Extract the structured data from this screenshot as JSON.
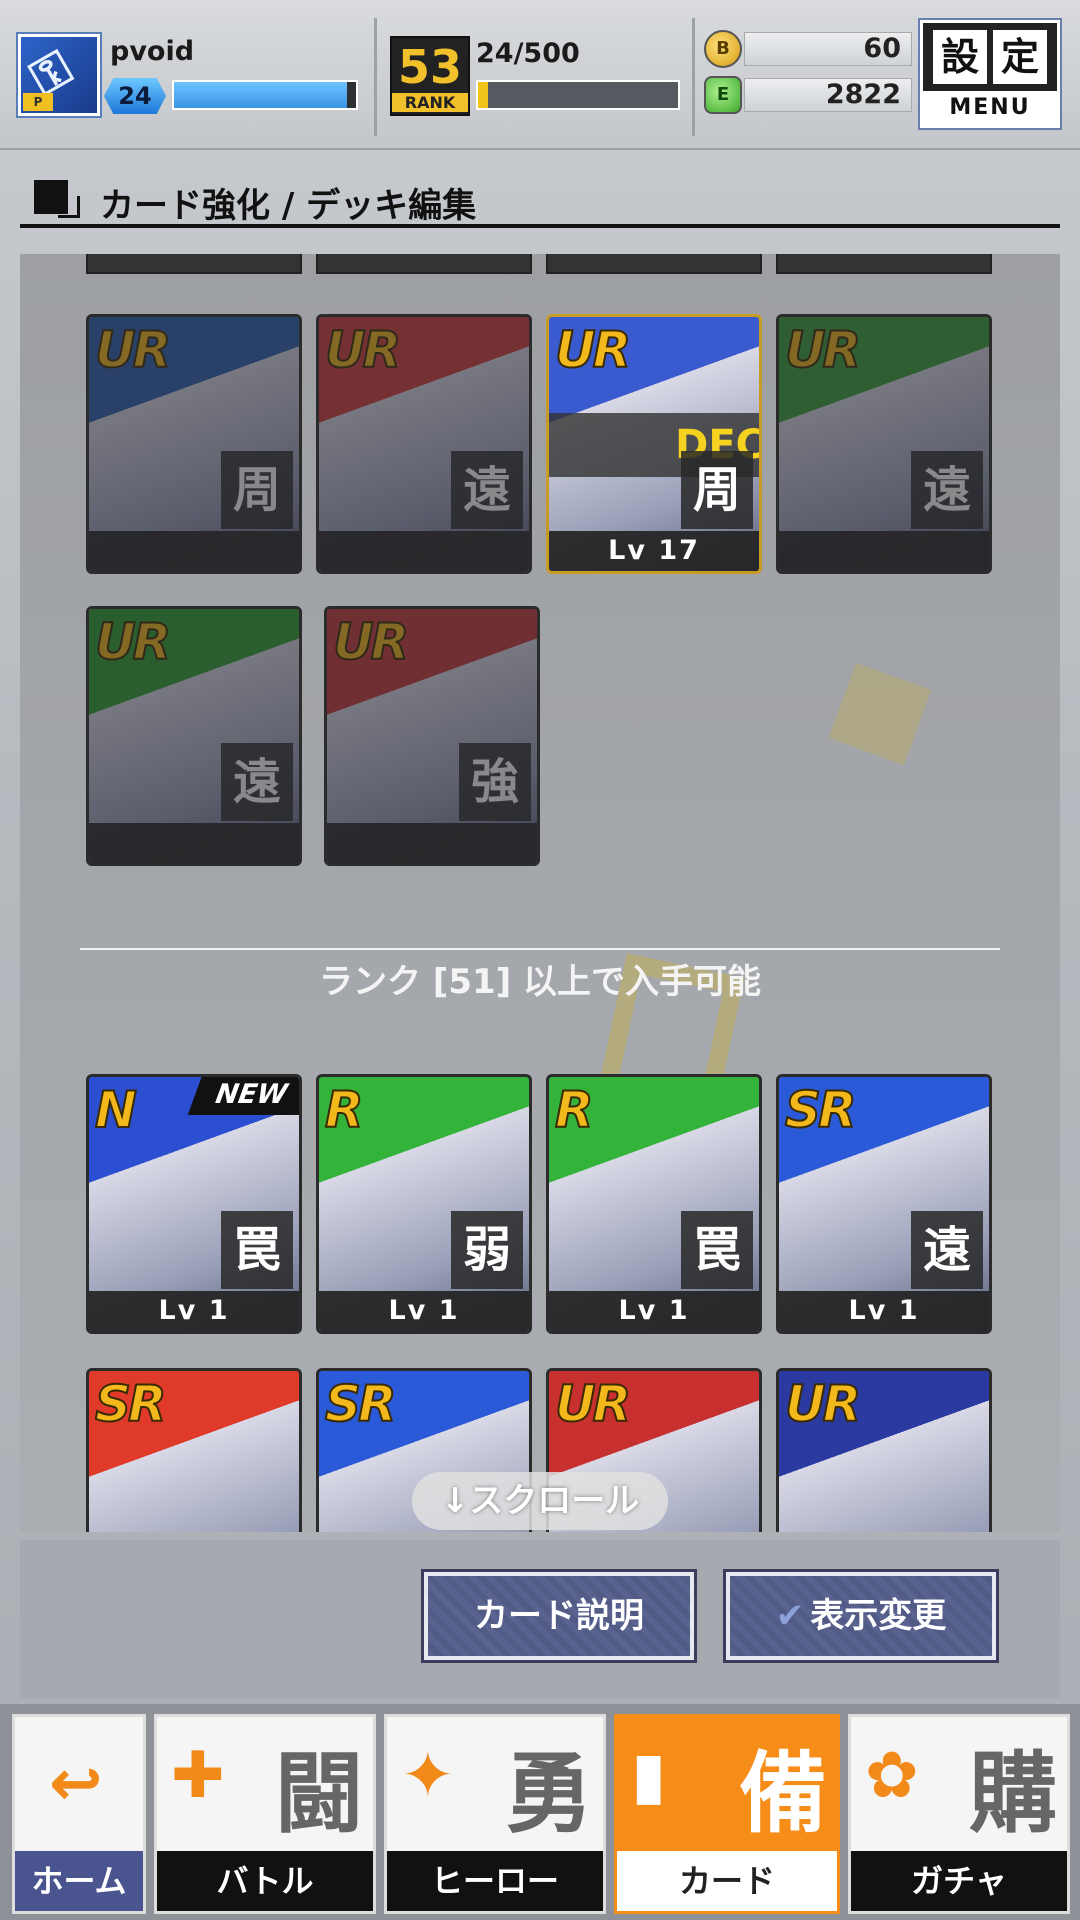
{
  "header": {
    "username": "pvoid",
    "level": "24",
    "exp_fill": 0.95,
    "rank_number": "53",
    "rank_label": "RANK",
    "rank_progress": "24/500",
    "rank_fill": 0.048,
    "gold_coins": "60",
    "green_gems": "2822",
    "menu_kanji_1": "設",
    "menu_kanji_2": "定",
    "menu_label": "MENU"
  },
  "section": {
    "title": "カード強化 / デッキ編集"
  },
  "owned_cards": [
    {
      "rarity": "UR",
      "type": "周",
      "level": "",
      "dim": true,
      "accent": "#2c5fb0"
    },
    {
      "rarity": "UR",
      "type": "遠",
      "level": "",
      "dim": true,
      "accent": "#d33a3a"
    },
    {
      "rarity": "UR",
      "type": "周",
      "level": "Lv 17",
      "dim": false,
      "accent": "#3a5ad0",
      "dec_label": "DEC"
    },
    {
      "rarity": "UR",
      "type": "遠",
      "level": "",
      "dim": true,
      "accent": "#3aa13a"
    },
    {
      "rarity": "UR",
      "type": "遠",
      "level": "",
      "dim": true,
      "accent": "#2fa02f"
    },
    {
      "rarity": "UR",
      "type": "強",
      "level": "",
      "dim": true,
      "accent": "#c83a3a"
    }
  ],
  "unlock_text": "ランク [51] 以上で入手可能",
  "available_cards": [
    {
      "rarity": "N",
      "type": "罠",
      "level": "Lv 1",
      "accent": "#2b4fd0",
      "new_label": "NEW"
    },
    {
      "rarity": "R",
      "type": "弱",
      "level": "Lv 1",
      "accent": "#33b33a"
    },
    {
      "rarity": "R",
      "type": "罠",
      "level": "Lv 1",
      "accent": "#33b33a"
    },
    {
      "rarity": "SR",
      "type": "遠",
      "level": "Lv 1",
      "accent": "#2b5ad8"
    },
    {
      "rarity": "SR",
      "type": "",
      "level": "",
      "accent": "#e03a2a"
    },
    {
      "rarity": "SR",
      "type": "",
      "level": "",
      "accent": "#2b5ad8"
    },
    {
      "rarity": "UR",
      "type": "",
      "level": "",
      "accent": "#c83030"
    },
    {
      "rarity": "UR",
      "type": "",
      "level": "",
      "accent": "#2b3aa0"
    }
  ],
  "scroll_hint": "↓スクロール",
  "actions": {
    "card_info": "カード説明",
    "display_change": "表示変更"
  },
  "nav": {
    "home": "ホーム",
    "battle_kanji": "闘",
    "battle": "バトル",
    "hero_kanji": "勇",
    "hero": "ヒーロー",
    "card_kanji": "備",
    "card": "カード",
    "gacha_kanji": "購",
    "gacha": "ガチャ"
  }
}
